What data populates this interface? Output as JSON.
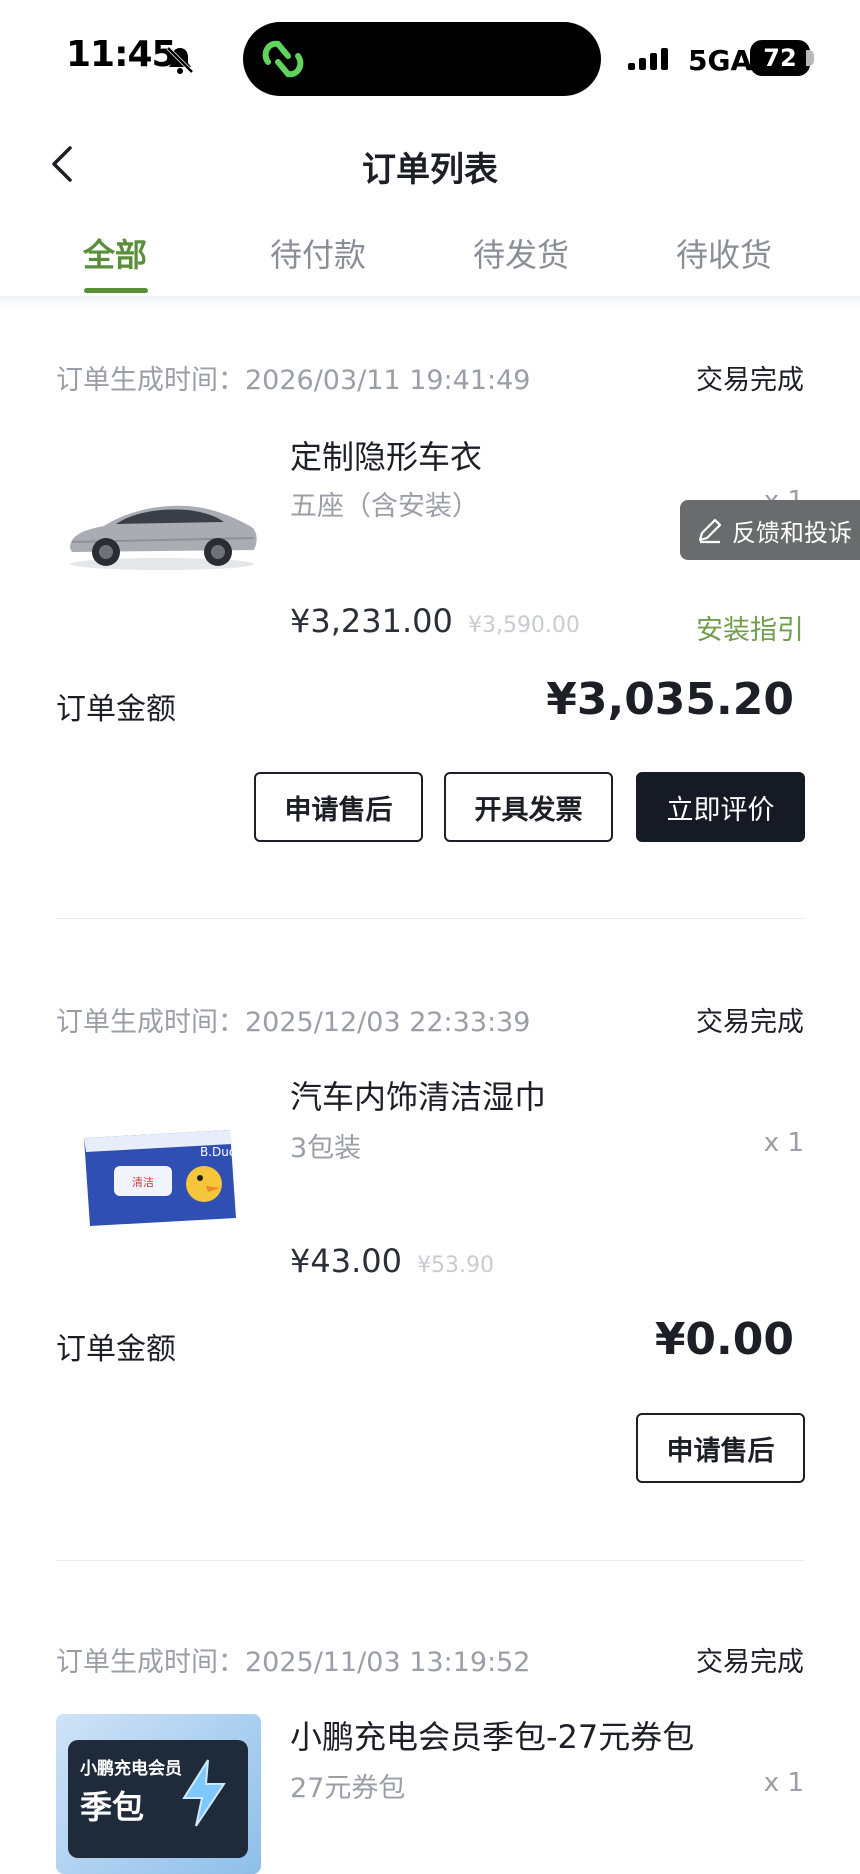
{
  "status_bar": {
    "time": "11:45",
    "network": "5GA",
    "battery": "72",
    "icons": [
      "bell-slash-icon",
      "app-logo-icon",
      "signal-icon"
    ]
  },
  "header": {
    "title": "订单列表",
    "back_icon": "chevron-left-icon"
  },
  "tabs": [
    {
      "label": "全部",
      "active": true
    },
    {
      "label": "待付款",
      "active": false
    },
    {
      "label": "待发货",
      "active": false
    },
    {
      "label": "待收货",
      "active": false
    }
  ],
  "feedback": {
    "label": "反馈和投诉",
    "icon": "pencil-icon"
  },
  "orders": [
    {
      "time_label": "订单生成时间：",
      "time": "2026/03/11 19:41:49",
      "status": "交易完成",
      "product": {
        "name": "定制隐形车衣",
        "spec": "五座（含安装）",
        "qty": "x 1",
        "price": "¥3,231.00",
        "original_price": "¥3,590.00",
        "link": "安装指引",
        "image": "car-image"
      },
      "total_label": "订单金额",
      "total": "¥3,035.20",
      "buttons": [
        "申请售后",
        "开具发票",
        "立即评价"
      ]
    },
    {
      "time_label": "订单生成时间：",
      "time": "2025/12/03 22:33:39",
      "status": "交易完成",
      "product": {
        "name": "汽车内饰清洁湿巾",
        "spec": "3包装",
        "qty": "x 1",
        "price": "¥43.00",
        "original_price": "¥53.90",
        "image": "wipes-image"
      },
      "total_label": "订单金额",
      "total": "¥0.00",
      "buttons": [
        "申请售后"
      ]
    },
    {
      "time_label": "订单生成时间：",
      "time": "2025/11/03 13:19:52",
      "status": "交易完成",
      "product": {
        "name": "小鹏充电会员季包-27元券包",
        "spec": "27元券包",
        "qty": "x 1",
        "image": "coupon-image",
        "image_text_1": "小鹏充电会员",
        "image_text_2": "季包"
      }
    }
  ],
  "colors": {
    "accent": "#5a8f3a",
    "link": "#6f9e4a",
    "dark_button": "#151a24"
  }
}
